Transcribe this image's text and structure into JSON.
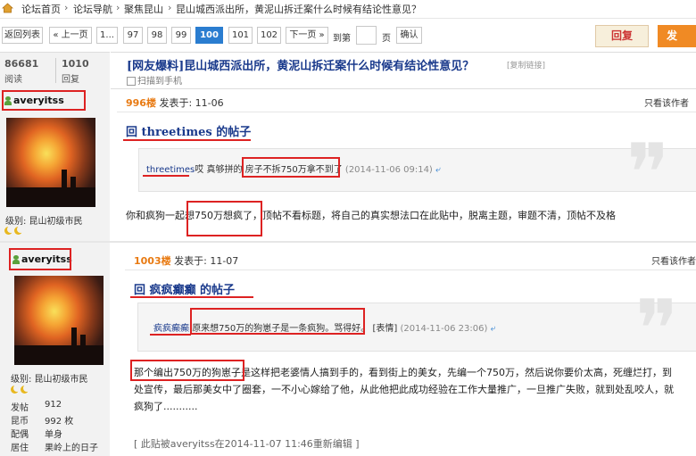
{
  "breadcrumb": {
    "items": [
      "论坛首页",
      "论坛导航",
      "聚焦昆山",
      "昆山城西派出所，黄泥山拆迁案什么时候有结论性意见？"
    ],
    "separator": "›"
  },
  "pager": {
    "back": "返回列表",
    "prev": "上一页",
    "first_ellipsis": "1...",
    "pages": [
      "97",
      "98",
      "99",
      "100",
      "101",
      "102"
    ],
    "current": "100",
    "next": "下一页",
    "goto_label": "到第",
    "page_unit": "页",
    "confirm": "确认",
    "reply": "回复",
    "post": "发"
  },
  "thread": {
    "views": "86681",
    "views_label": "阅读",
    "replies": "1010",
    "replies_label": "回复",
    "title": "[网友爆料]昆山城西派出所，黄泥山拆迁案什么时候有结论性意见？",
    "copy_link": "[复制链接]",
    "scan_phone": "扫描到手机"
  },
  "posts": [
    {
      "username": "averyitss",
      "level": "级别: 昆山初级市民",
      "floor": "996楼",
      "posted_at": "发表于: 11-06",
      "only_author": "只看该作者",
      "reply_title": "回  threetimes 的帖子",
      "quote_user": "threetimes",
      "quote_pre": "哎 真够拼的",
      "quote_highlight": "房子不拆750万拿不到了",
      "quote_time": "(2014-11-06 09:14)",
      "body": "你和疯狗一起想750万想疯了，顶帖不看标题，将自己的真实想法口在此贴中，脱离主题，审题不清，顶帖不及格"
    },
    {
      "username": "averyitss",
      "level": "级别: 昆山初级市民",
      "floor": "1003楼",
      "posted_at": "发表于: 11-07",
      "only_author": "只看该作者",
      "reply_title": "回  疯疯癫癫 的帖子",
      "quote_user": "疯疯癫癫",
      "quote_highlight": "原来想750万的狗崽子是一条疯狗。骂得好。",
      "quote_emote": "[表情]",
      "quote_time": "(2014-11-06 23:06)",
      "body_lines": [
        "那个编出750万的狗崽子是这样把老婆情人搞到手的，看到街上的美女，先编一个750万，然后说你要价太高，死缠烂打，到",
        "处宣传，最后那美女中了圈套，一不小心嫁给了他，从此他把此成功经验在工作大量推广，一旦推广失败，就到处乱咬人，就",
        "疯狗了..........."
      ],
      "edit_note": "[ 此贴被averyitss在2014-11-07 11:46重新编辑 ]",
      "stats": [
        {
          "label": "发帖",
          "value": "912"
        },
        {
          "label": "昆币",
          "value": "992 枚"
        },
        {
          "label": "配偶",
          "value": "单身"
        },
        {
          "label": "居住",
          "value": "果岭上的日子"
        }
      ]
    }
  ]
}
